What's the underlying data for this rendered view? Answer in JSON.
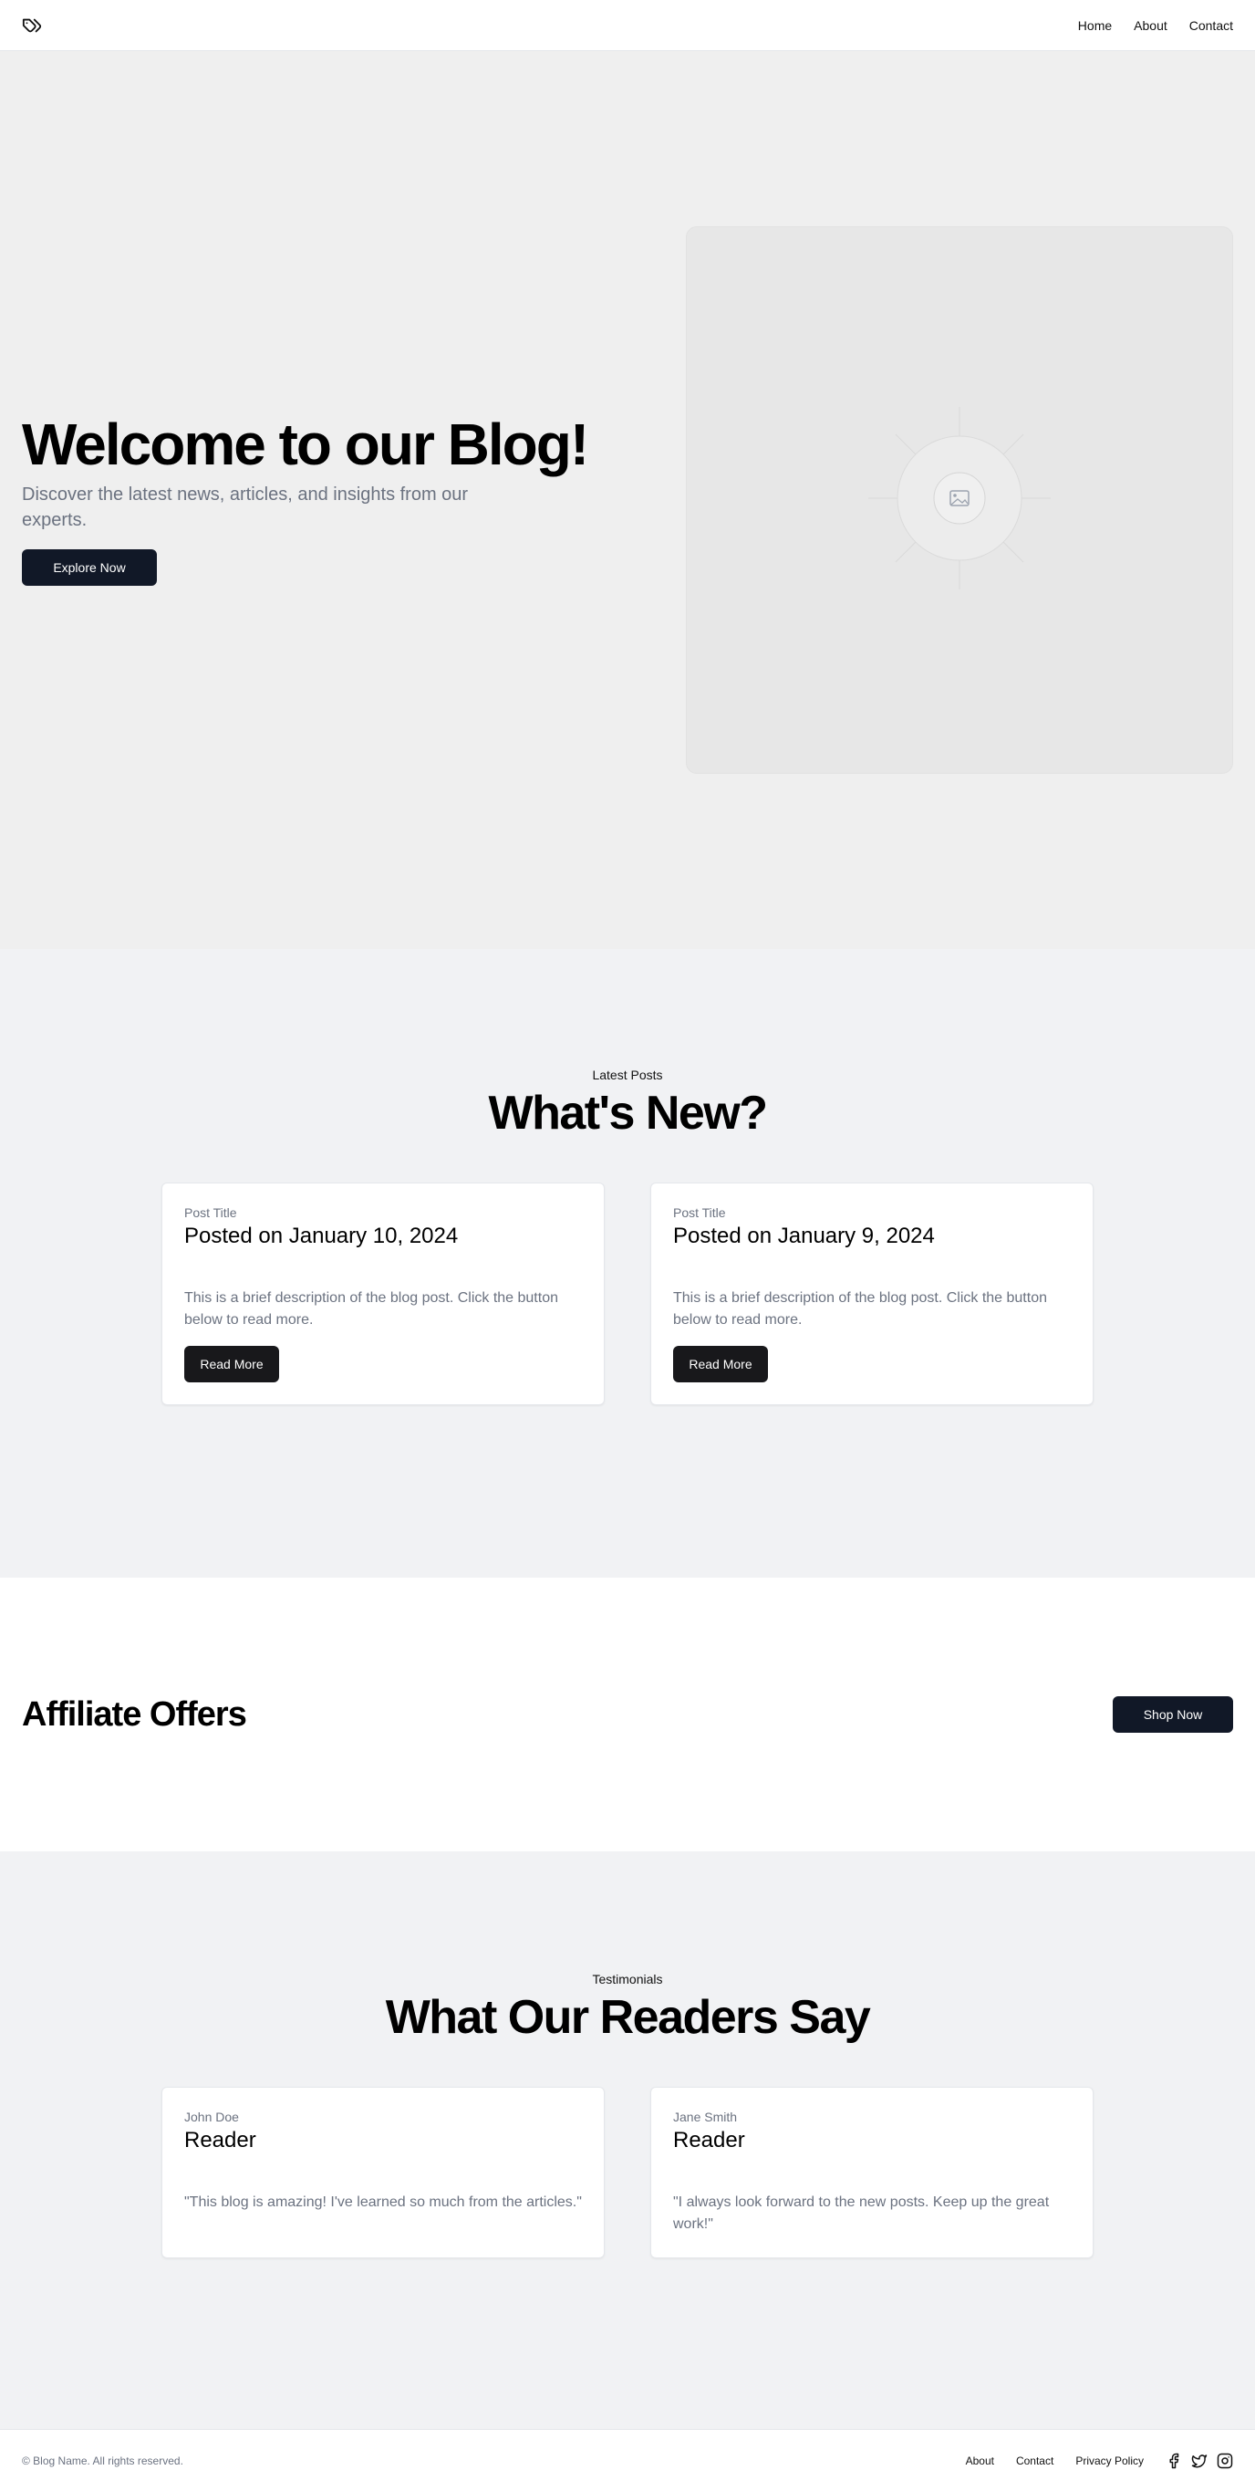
{
  "header": {
    "logo_icon": "tags-icon",
    "nav": [
      {
        "label": "Home"
      },
      {
        "label": "About"
      },
      {
        "label": "Contact"
      }
    ]
  },
  "hero": {
    "title": "Welcome to our Blog!",
    "subtitle": "Discover the latest news, articles, and insights from our experts.",
    "button": "Explore Now",
    "image_icon": "image-placeholder-icon"
  },
  "posts": {
    "eyebrow": "Latest Posts",
    "title": "What's New?",
    "items": [
      {
        "eyebrow": "Post Title",
        "title": "Posted on January 10, 2024",
        "description": "This is a brief description of the blog post. Click the button below to read more.",
        "button": "Read More"
      },
      {
        "eyebrow": "Post Title",
        "title": "Posted on January 9, 2024",
        "description": "This is a brief description of the blog post. Click the button below to read more.",
        "button": "Read More"
      }
    ]
  },
  "affiliate": {
    "title": "Affiliate Offers",
    "button": "Shop Now"
  },
  "testimonials": {
    "eyebrow": "Testimonials",
    "title": "What Our Readers Say",
    "items": [
      {
        "name": "John Doe",
        "role": "Reader",
        "quote": "\"This blog is amazing! I've learned so much from the articles.\""
      },
      {
        "name": "Jane Smith",
        "role": "Reader",
        "quote": "\"I always look forward to the new posts. Keep up the great work!\""
      }
    ]
  },
  "footer": {
    "copyright": "© Blog Name. All rights reserved.",
    "links": [
      {
        "label": "About"
      },
      {
        "label": "Contact"
      },
      {
        "label": "Privacy Policy"
      }
    ],
    "social_icons": [
      "facebook-icon",
      "twitter-icon",
      "instagram-icon"
    ]
  }
}
